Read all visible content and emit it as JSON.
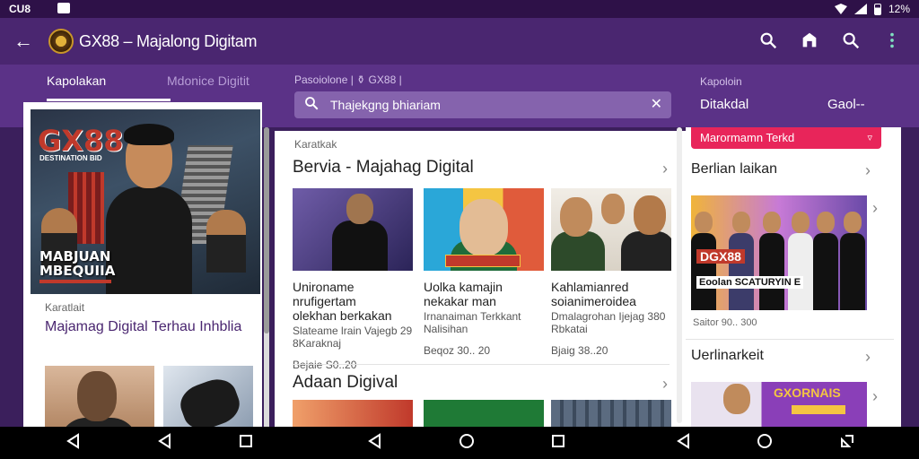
{
  "status_bar": {
    "time": "CU8",
    "battery": "12%"
  },
  "app_bar": {
    "title": "GX88 – Majalong Digitam"
  },
  "left": {
    "tabs": [
      {
        "label": "Kapolakan"
      },
      {
        "label": "Mdonice Digitit"
      }
    ],
    "hero": {
      "brand": "GX88",
      "brand_sub": "DESTINATION BID",
      "caption_line1": "MABJUAN",
      "caption_line2": "MBEQUIIA"
    },
    "category": "Karatlait",
    "title": "Majamag Digital Terhau Inhblia"
  },
  "middle": {
    "breadcrumb": "Pasoiolone | ⚱ GX88 |",
    "search_value": "Thajekgng bhiariam",
    "category": "Karatkak",
    "section_title": "Bervia - Majahag Digital",
    "cards": [
      {
        "title": "Unironame nrufigertam",
        "subtitle": "olekhan berkakan",
        "meta": "Slateame lrain Vajegb 29 8Karaknaj",
        "date": "Bejaie S0..20"
      },
      {
        "title": "Uolka kamajin",
        "subtitle": "nekakar man",
        "meta": "Irnanaiman Terkkant Nalisihan",
        "date": "Beqoz 30.. 20"
      },
      {
        "title": "Kahlamianred",
        "subtitle": "soianimeroidea",
        "meta": "Dmalagrohan Ijejag 380 Rbkatai",
        "date": "Bjaig 38..20"
      }
    ],
    "section2_title": "Adaan Digival"
  },
  "right": {
    "breadcrumb": "Kapoloin",
    "label": "Ditakdal",
    "goal": "Gaol--",
    "alert": "Marormamn Terkd",
    "section1_title": "Berlian laikan",
    "img1_brand": "DGX88",
    "img1_caption": "Eoolan SCATURYIN E",
    "date": "Saitor 90.. 300",
    "section2_title": "Uerlinarkeit",
    "img2_brand": "GXORNAIS"
  },
  "colors": {
    "primary": "#4a2670",
    "accent": "#e8255a",
    "surface": "#ffffff"
  },
  "icons": [
    "back-arrow-icon",
    "search-icon",
    "home-icon",
    "more-vert-icon",
    "close-icon",
    "chevron-right-icon",
    "nav-back-icon",
    "nav-home-icon",
    "nav-recents-icon"
  ]
}
